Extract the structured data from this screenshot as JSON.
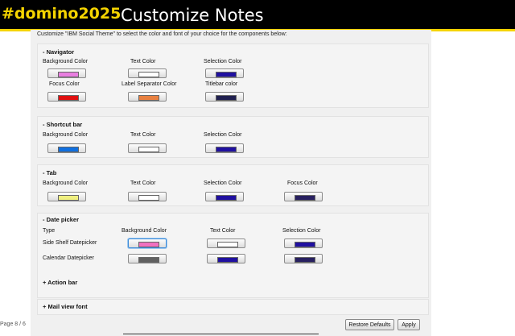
{
  "header": {
    "hashtag": "#domino2025",
    "title": "Customize Notes"
  },
  "intro": "Customize \"IBM Social Theme\" to select the color and font of your choice for the components below:",
  "navigator": {
    "title": "- Navigator",
    "background_label": "Background Color",
    "background_color": "#e87ee0",
    "text_label": "Text Color",
    "text_color": "#ffffff",
    "selection_label": "Selection Color",
    "selection_color": "#2010a0",
    "focus_label": "Focus Color",
    "focus_color": "#e01010",
    "separator_label": "Label Separator Color",
    "separator_color": "#e88040",
    "titlebar_label": "Titlebar color",
    "titlebar_color": "#202050"
  },
  "shortcut": {
    "title": "- Shortcut bar",
    "background_label": "Background Color",
    "background_color": "#1070e0",
    "text_label": "Text Color",
    "text_color": "#ffffff",
    "selection_label": "Selection Color",
    "selection_color": "#2010a0"
  },
  "tab": {
    "title": "- Tab",
    "background_label": "Background Color",
    "background_color": "#f0f080",
    "text_label": "Text Color",
    "text_color": "#ffffff",
    "selection_label": "Selection Color",
    "selection_color": "#2010a0",
    "focus_label": "Focus Color",
    "focus_color": "#282060"
  },
  "datepicker": {
    "title": "- Date picker",
    "type_label": "Type",
    "background_label": "Background Color",
    "text_label": "Text Color",
    "selection_label": "Selection Color",
    "side_shelf_label": "Side Shelf Datepicker",
    "calendar_label": "Calendar Datepicker",
    "side_background_color": "#f070c0",
    "side_text_color": "#ffffff",
    "side_selection_color": "#2010a0",
    "cal_background_color": "#606060",
    "cal_text_color": "#2010a0",
    "cal_selection_color": "#282060"
  },
  "action_bar": {
    "title": "+ Action bar"
  },
  "mail_font": {
    "title": "+ Mail view font"
  },
  "buttons": {
    "restore": "Restore Defaults",
    "apply": "Apply"
  },
  "page_number": "Page 8 / 6"
}
